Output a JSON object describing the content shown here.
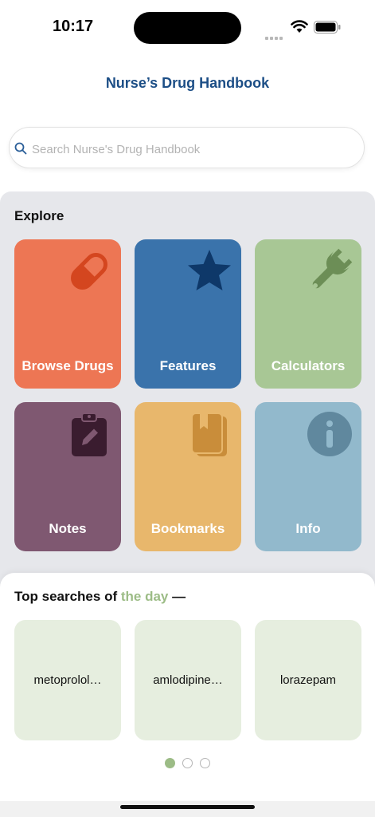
{
  "status": {
    "time": "10:17"
  },
  "nav": {
    "title": "Nurse’s Drug Handbook"
  },
  "search": {
    "placeholder": "Search Nurse's Drug Handbook"
  },
  "explore": {
    "title": "Explore",
    "tiles": [
      {
        "label": "Browse Drugs",
        "color": "#ed7654",
        "icon": "pill-icon"
      },
      {
        "label": "Features",
        "color": "#3a73ab",
        "icon": "star-icon"
      },
      {
        "label": "Calculators",
        "color": "#a8c795",
        "icon": "wrench-icon"
      },
      {
        "label": "Notes",
        "color": "#7f5871",
        "icon": "clipboard-edit-icon"
      },
      {
        "label": "Bookmarks",
        "color": "#e8b76c",
        "icon": "book-bookmark-icon"
      },
      {
        "label": "Info",
        "color": "#92b9cc",
        "icon": "info-icon"
      }
    ]
  },
  "top_searches": {
    "title_prefix": "Top searches of ",
    "title_accent": "the day",
    "title_suffix": " —",
    "items": [
      "metoprolol…",
      "amlodipine…",
      "lorazepam"
    ],
    "page_count": 3,
    "active_page": 1
  },
  "colors": {
    "brand_blue": "#1c4e86",
    "accent_green": "#9cbc86",
    "panel_gray": "#e6e7eb"
  }
}
